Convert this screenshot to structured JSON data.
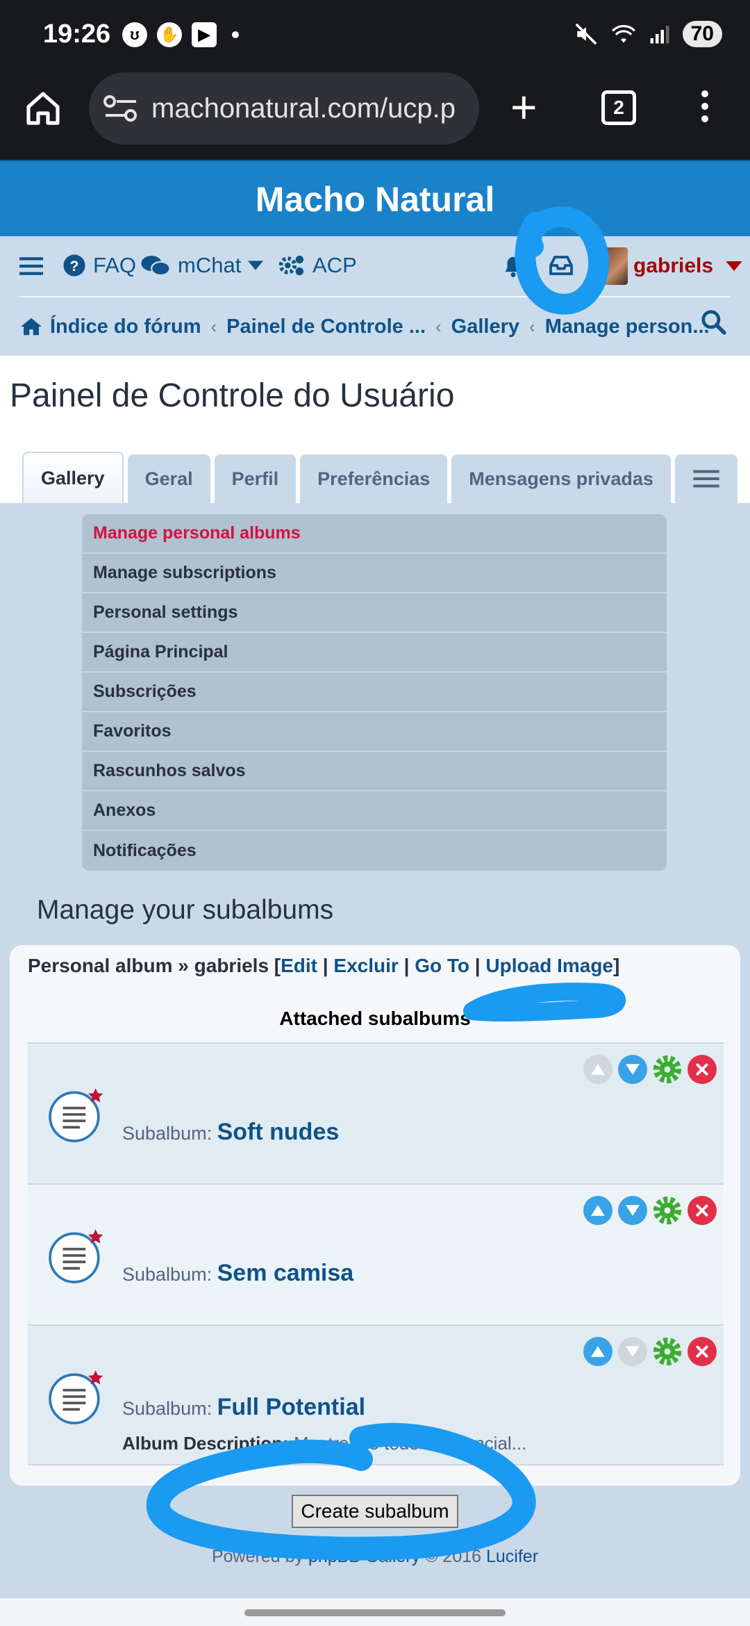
{
  "status_bar": {
    "time": "19:26",
    "battery": "70"
  },
  "browser": {
    "url": "machonatural.com/ucp.p",
    "tab_count": "2"
  },
  "site": {
    "title": "Macho Natural"
  },
  "nav": {
    "faq": "FAQ",
    "mchat": "mChat",
    "acp": "ACP",
    "username": "gabriels",
    "breadcrumbs": [
      "Índice do fórum",
      "Painel de Controle ...",
      "Gallery",
      "Manage person..."
    ]
  },
  "page": {
    "title": "Painel de Controle do Usuário",
    "tabs": [
      "Gallery",
      "Geral",
      "Perfil",
      "Preferências",
      "Mensagens privadas"
    ]
  },
  "menu": {
    "items": [
      "Manage personal albums",
      "Manage subscriptions",
      "Personal settings",
      "Página Principal",
      "Subscrições",
      "Favoritos",
      "Rascunhos salvos",
      "Anexos",
      "Notificações"
    ]
  },
  "section": {
    "title": "Manage your subalbums",
    "album_prefix": "Personal album » gabriels [",
    "edit": "Edit",
    "delete": "Excluir",
    "goto": "Go To",
    "upload": "Upload Image",
    "attached": "Attached subalbums",
    "sub_label": "Subalbum:",
    "desc_label": "Album Description:",
    "subalbums": [
      {
        "name": "Soft nudes",
        "description": ""
      },
      {
        "name": "Sem camisa",
        "description": ""
      },
      {
        "name": "Full Potential",
        "description": "Mostrando todo o potencial..."
      }
    ]
  },
  "create_button": "Create subalbum",
  "footer": {
    "prefix": "Powered by ",
    "link": "phpBB Gallery",
    "middle": " © 2016 ",
    "author": "Lucifer"
  },
  "colors": {
    "header_blue": "#1a82c9",
    "link": "#105289",
    "active_red": "#d31141",
    "annotation": "#1a9af0"
  }
}
